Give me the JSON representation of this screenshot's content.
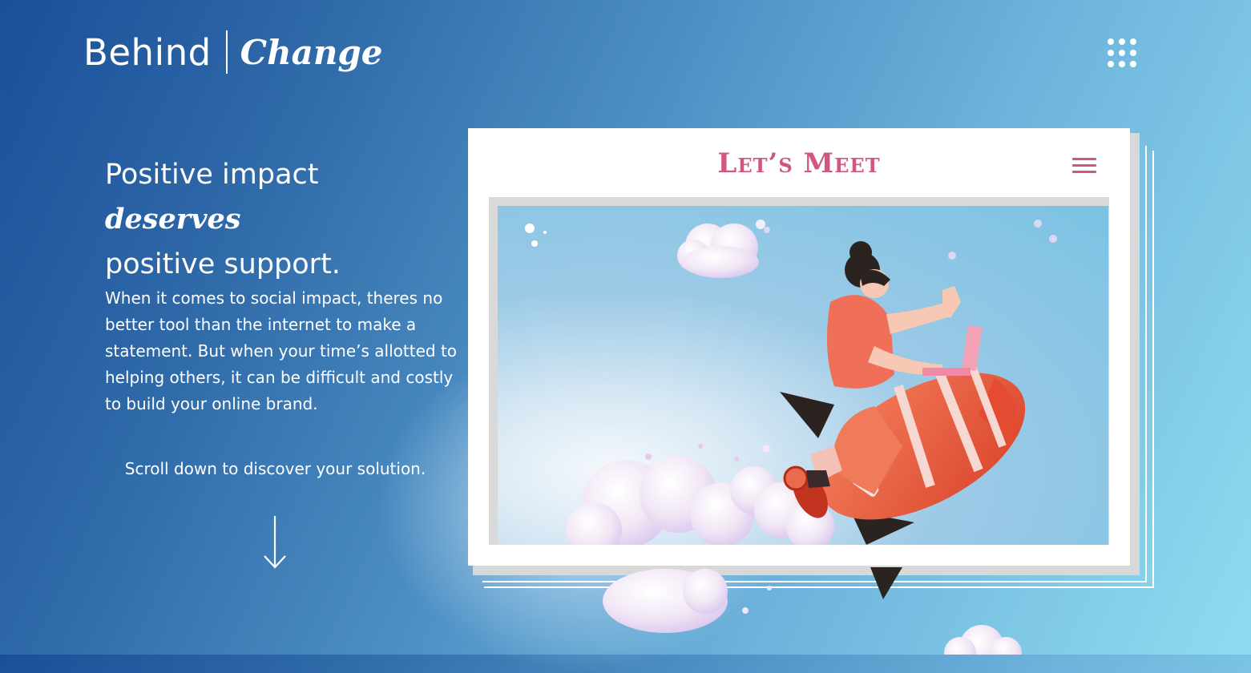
{
  "brand": {
    "name_part1": "Behind",
    "name_part2": "Change"
  },
  "hero": {
    "headline_start": "Positive impact ",
    "headline_emphasis": "deserves",
    "headline_end": "positive support.",
    "body": "When it comes to social impact, theres no better tool than the internet to make a statement. But when your time’s allotted to helping others, it can be difficult and costly to build your online brand.",
    "scroll_cta": "Scroll down to discover your solution."
  },
  "mockup": {
    "site_title": "Let’s Meet"
  },
  "icons": {
    "menu": "grid-dots-icon",
    "scroll": "arrow-down-icon",
    "mock_menu": "hamburger-icon"
  },
  "colors": {
    "accent_pink": "#d1577f",
    "background_start": "#1b4f98",
    "background_end": "#8fdcef"
  }
}
